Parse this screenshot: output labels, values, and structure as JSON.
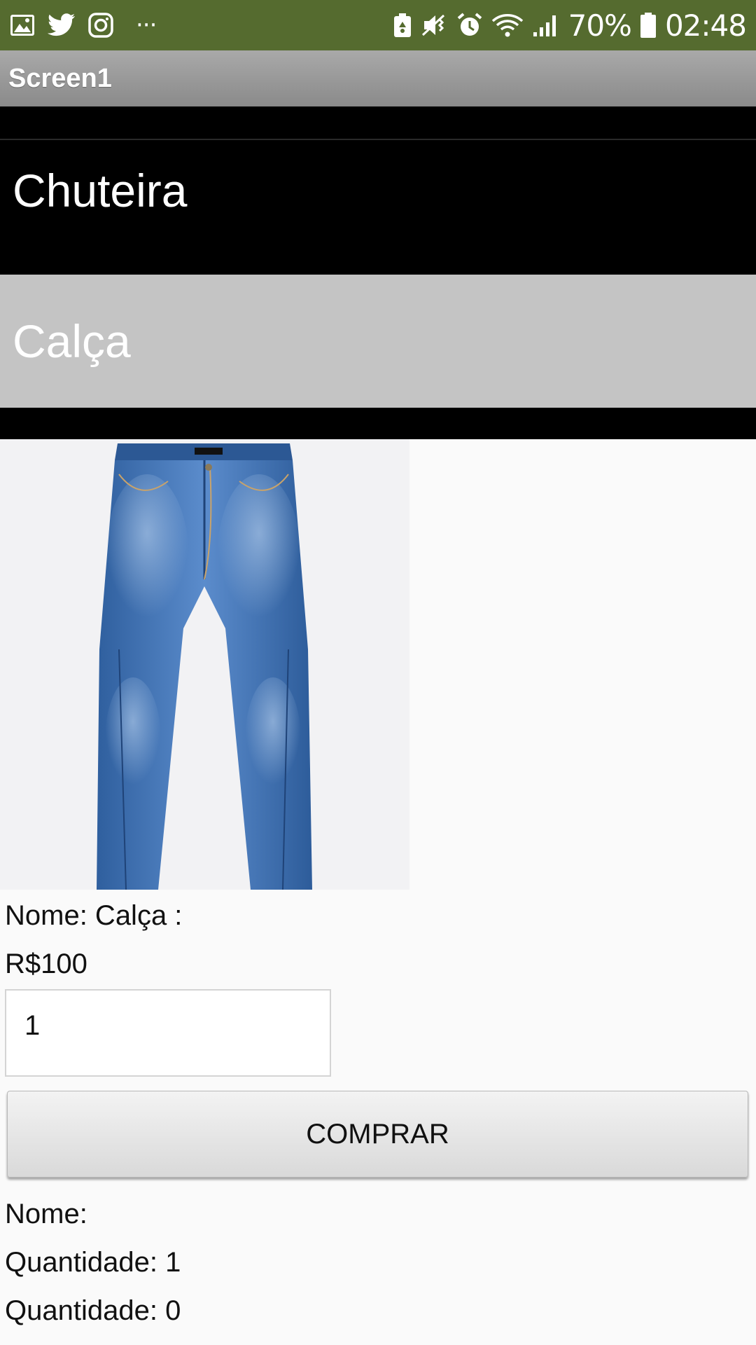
{
  "status_bar": {
    "icons_left": [
      "gallery-icon",
      "twitter-icon",
      "instagram-icon",
      "more-icon"
    ],
    "more_label": "···",
    "icons_right": [
      "recycle-icon",
      "mute-vibrate-icon",
      "alarm-icon",
      "wifi-icon",
      "signal-icon",
      "battery-icon"
    ],
    "battery": "70%",
    "time": "02:48",
    "color": "#556b2f"
  },
  "title_bar": {
    "title": "Screen1"
  },
  "list": {
    "items": [
      {
        "label": "Chuteira"
      },
      {
        "label": "Calça"
      }
    ],
    "selected_index": 1
  },
  "product": {
    "image": "jeans-photo",
    "name_label": "Nome: Calça :",
    "price_label": "R$100",
    "quantity_value": "1",
    "buy_label": "COMPRAR"
  },
  "summary": {
    "name_label": "Nome:",
    "quantity_label_1": "Quantidade: 1",
    "quantity_label_2": "Quantidade: 0"
  }
}
